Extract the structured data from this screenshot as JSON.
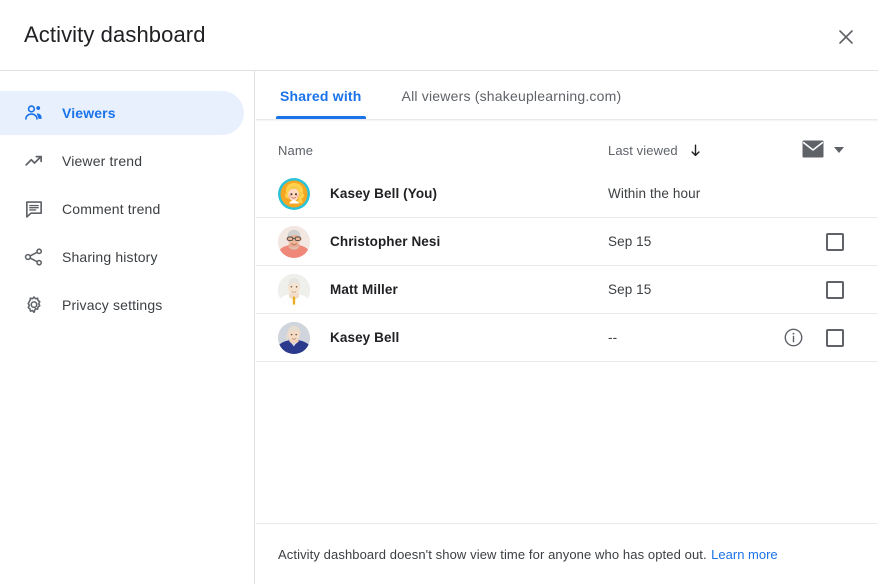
{
  "header": {
    "title": "Activity dashboard",
    "close_icon": "close-icon"
  },
  "sidebar": {
    "items": [
      {
        "label": "Viewers",
        "icon": "people-icon",
        "selected": true
      },
      {
        "label": "Viewer trend",
        "icon": "trending-up-icon",
        "selected": false
      },
      {
        "label": "Comment trend",
        "icon": "comment-icon",
        "selected": false
      },
      {
        "label": "Sharing history",
        "icon": "share-icon",
        "selected": false
      },
      {
        "label": "Privacy settings",
        "icon": "gear-icon",
        "selected": false
      }
    ]
  },
  "main": {
    "tabs": [
      {
        "label": "Shared with",
        "active": true
      },
      {
        "label": "All viewers (shakeuplearning.com)",
        "active": false
      }
    ],
    "table": {
      "columns": {
        "name": "Name",
        "last_viewed": "Last viewed",
        "sort_direction_icon": "arrow-down-icon",
        "mail_icon": "mail-icon",
        "caret_icon": "chevron-down-icon"
      },
      "rows": [
        {
          "name": "Kasey Bell (You)",
          "last_viewed": "Within the hour",
          "avatar": "avatar-kasey-cartoon",
          "has_info": false,
          "has_checkbox": false
        },
        {
          "name": "Christopher Nesi",
          "last_viewed": "Sep 15",
          "avatar": "avatar-christopher-photo",
          "has_info": false,
          "has_checkbox": true
        },
        {
          "name": "Matt Miller",
          "last_viewed": "Sep 15",
          "avatar": "avatar-matt-photo",
          "has_info": false,
          "has_checkbox": true
        },
        {
          "name": "Kasey Bell",
          "last_viewed": "--",
          "avatar": "avatar-kasey-photo",
          "has_info": true,
          "has_checkbox": true
        }
      ]
    }
  },
  "footer": {
    "text": "Activity dashboard doesn't show view time for anyone who has opted out.",
    "link": "Learn more"
  },
  "colors": {
    "accent": "#1a73e8",
    "accent_bg": "#e8f0fe",
    "text_primary": "#202124",
    "text_secondary": "#5f6368",
    "divider": "#e8eaed"
  }
}
